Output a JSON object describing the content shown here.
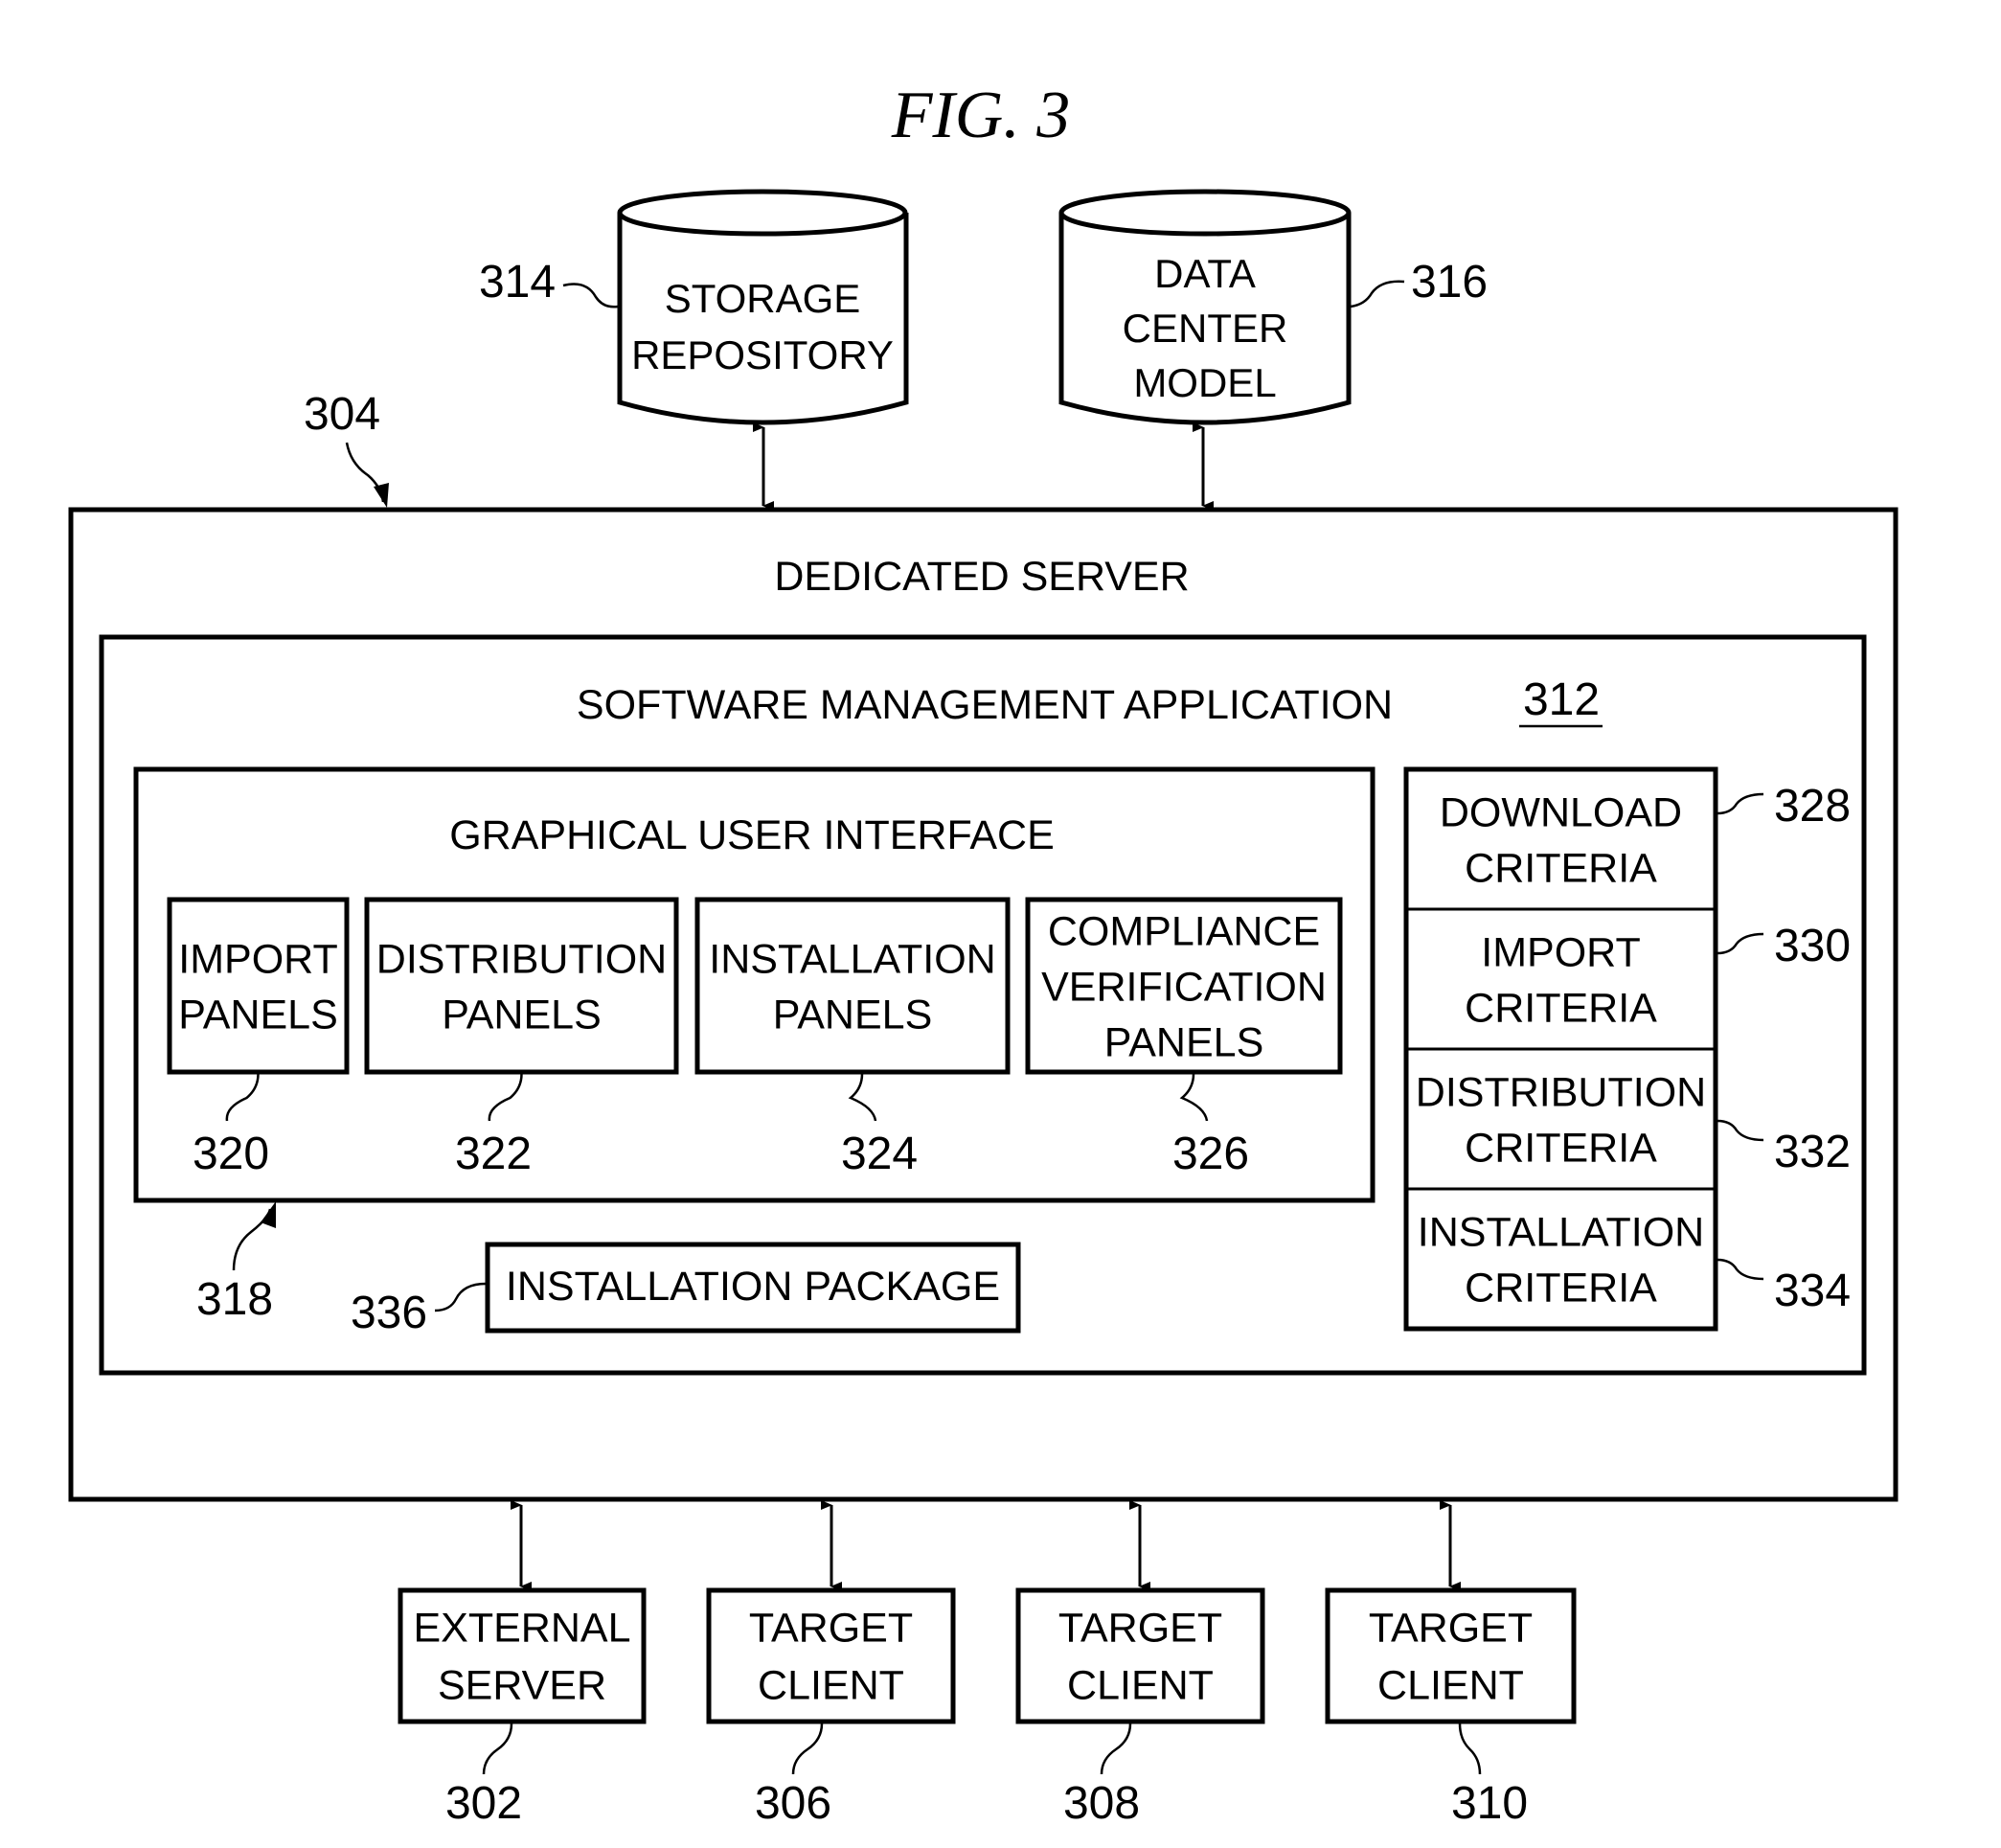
{
  "figure": {
    "title": "FIG. 3"
  },
  "databases": [
    {
      "id": "storage",
      "lines": [
        "STORAGE",
        "REPOSITORY"
      ],
      "ref": "314"
    },
    {
      "id": "datacenter",
      "lines": [
        "DATA",
        "CENTER",
        "MODEL"
      ],
      "ref": "316"
    }
  ],
  "dedicated_server": {
    "label": "DEDICATED SERVER",
    "ref": "304"
  },
  "software_app": {
    "label": "SOFTWARE MANAGEMENT APPLICATION",
    "ref": "312"
  },
  "gui": {
    "label": "GRAPHICAL USER INTERFACE",
    "ref": "318",
    "panels": [
      {
        "lines": [
          "IMPORT",
          "PANELS"
        ],
        "ref": "320"
      },
      {
        "lines": [
          "DISTRIBUTION",
          "PANELS"
        ],
        "ref": "322"
      },
      {
        "lines": [
          "INSTALLATION",
          "PANELS"
        ],
        "ref": "324"
      },
      {
        "lines": [
          "COMPLIANCE",
          "VERIFICATION",
          "PANELS"
        ],
        "ref": "326"
      }
    ]
  },
  "installation_package": {
    "label": "INSTALLATION PACKAGE",
    "ref": "336"
  },
  "criteria": [
    {
      "lines": [
        "DOWNLOAD",
        "CRITERIA"
      ],
      "ref": "328"
    },
    {
      "lines": [
        "IMPORT",
        "CRITERIA"
      ],
      "ref": "330"
    },
    {
      "lines": [
        "DISTRIBUTION",
        "CRITERIA"
      ],
      "ref": "332"
    },
    {
      "lines": [
        "INSTALLATION",
        "CRITERIA"
      ],
      "ref": "334"
    }
  ],
  "clients": [
    {
      "lines": [
        "EXTERNAL",
        "SERVER"
      ],
      "ref": "302"
    },
    {
      "lines": [
        "TARGET",
        "CLIENT"
      ],
      "ref": "306"
    },
    {
      "lines": [
        "TARGET",
        "CLIENT"
      ],
      "ref": "308"
    },
    {
      "lines": [
        "TARGET",
        "CLIENT"
      ],
      "ref": "310"
    }
  ]
}
